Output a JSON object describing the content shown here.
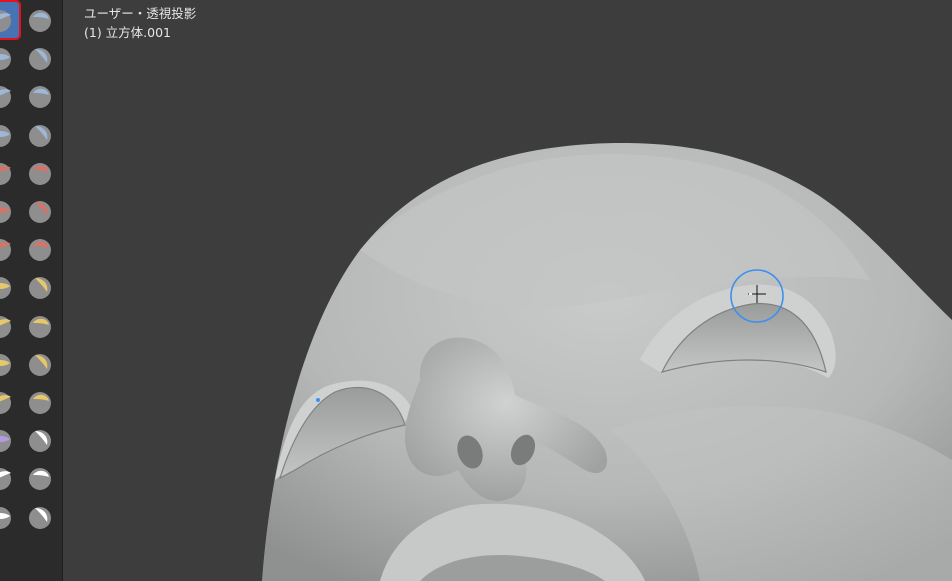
{
  "viewport": {
    "view_label": "ユーザー・透視投影",
    "object_label": "(1) 立方体.001"
  },
  "colors": {
    "background": "#3d3d3d",
    "toolbar": "#2b2b2b",
    "active_tool": "#4772b3",
    "highlight_box": "#e3121b",
    "brush_circle": "#3d8ff0",
    "mesh": "#b9bbbb"
  },
  "toolbar": {
    "active_tool": "draw-brush",
    "tools": [
      {
        "name": "draw-brush",
        "color": "#9db7d6"
      },
      {
        "name": "draw-sharp-brush",
        "color": "#9db7d6"
      },
      {
        "name": "clay-brush",
        "color": "#9db7d6"
      },
      {
        "name": "clay-strips-brush",
        "color": "#9db7d6"
      },
      {
        "name": "clay-thumb-brush",
        "color": "#9db7d6"
      },
      {
        "name": "layer-brush",
        "color": "#9db7d6"
      },
      {
        "name": "inflate-brush",
        "color": "#9db7d6"
      },
      {
        "name": "blob-brush",
        "color": "#9db7d6"
      },
      {
        "name": "crease-brush",
        "color": "#d4736a"
      },
      {
        "name": "smooth-brush",
        "color": "#d4736a"
      },
      {
        "name": "flatten-brush",
        "color": "#d4736a"
      },
      {
        "name": "fill-brush",
        "color": "#d4736a"
      },
      {
        "name": "scrape-brush",
        "color": "#d4736a"
      },
      {
        "name": "multiplane-scrape-brush",
        "color": "#d4736a"
      },
      {
        "name": "pinch-brush",
        "color": "#e6c86a"
      },
      {
        "name": "grab-brush",
        "color": "#e6c86a"
      },
      {
        "name": "elastic-deform-brush",
        "color": "#e6c86a"
      },
      {
        "name": "snake-hook-brush",
        "color": "#e6c86a"
      },
      {
        "name": "thumb-brush",
        "color": "#e6c86a"
      },
      {
        "name": "pose-brush",
        "color": "#e6c86a"
      },
      {
        "name": "nudge-brush",
        "color": "#e6c86a"
      },
      {
        "name": "rotate-brush",
        "color": "#e6c86a"
      },
      {
        "name": "slide-relax-brush",
        "color": "#b49ae0"
      },
      {
        "name": "boundary-brush",
        "color": "#ffffff"
      },
      {
        "name": "cloth-brush",
        "color": "#ffffff"
      },
      {
        "name": "simplify-brush",
        "color": "#ffffff"
      },
      {
        "name": "mask-brush",
        "color": "#ffffff"
      },
      {
        "name": "draw-face-sets-brush",
        "color": "#ffffff"
      }
    ]
  }
}
